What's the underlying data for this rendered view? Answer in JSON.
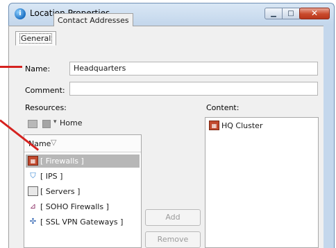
{
  "window": {
    "title": "Location Properties"
  },
  "tabs": [
    {
      "label": "General",
      "selected": true
    },
    {
      "label": "Contact Addresses",
      "selected": false
    }
  ],
  "form": {
    "name_label": "Name:",
    "name_value": "Headquarters",
    "comment_label": "Comment:",
    "comment_value": ""
  },
  "resources": {
    "label": "Resources:",
    "breadcrumb": "Home",
    "column_header": "Name",
    "items": [
      {
        "label": "[ Firewalls ]",
        "icon": "firewall-icon",
        "selected": true
      },
      {
        "label": "[ IPS ]",
        "icon": "ips-icon",
        "selected": false
      },
      {
        "label": "[ Servers ]",
        "icon": "server-icon",
        "selected": false
      },
      {
        "label": "[ SOHO Firewalls ]",
        "icon": "soho-firewall-icon",
        "selected": false
      },
      {
        "label": "[ SSL VPN Gateways ]",
        "icon": "ssl-vpn-icon",
        "selected": false
      }
    ]
  },
  "content": {
    "label": "Content:",
    "items": [
      {
        "label": "HQ Cluster",
        "icon": "firewall-cluster-icon"
      }
    ]
  },
  "buttons": {
    "add": "Add",
    "remove": "Remove"
  },
  "colors": {
    "callout": "#d5221f",
    "selection": "#b7b7b7",
    "close_button": "#c94a2c"
  }
}
